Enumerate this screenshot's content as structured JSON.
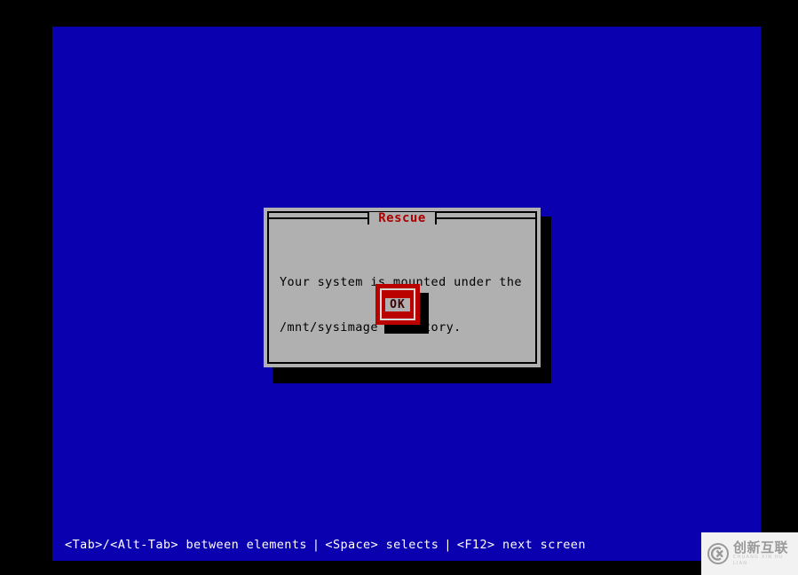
{
  "screen": {
    "background_color": "#0a00b0",
    "letterbox_color": "#000000"
  },
  "dialog": {
    "title": "Rescue",
    "title_color": "#aa0000",
    "background_color": "#b0b0b0",
    "border_color": "#000000",
    "shadow_color": "#000000",
    "message": {
      "line1": "Your system is mounted under the",
      "line2": "/mnt/sysimage directory."
    },
    "buttons": [
      {
        "label": "OK",
        "focused": true,
        "background_color": "#bb0000",
        "frame_color": "#d8d8d8",
        "label_background": "#b0b0b0",
        "label_color": "#3a0000"
      }
    ]
  },
  "status_bar": {
    "text_color": "#ffffff",
    "hint_tab": "<Tab>/<Alt-Tab> between elements",
    "separator": "|",
    "hint_space": "<Space> selects",
    "hint_f12": "<F12> next screen"
  },
  "watermark": {
    "logo_icon": "cx-circle-logo-icon",
    "chinese_text": "创新互联",
    "latin_text": "CHUANG XIN HU LIAN",
    "background_color": "#f2f2f2"
  }
}
